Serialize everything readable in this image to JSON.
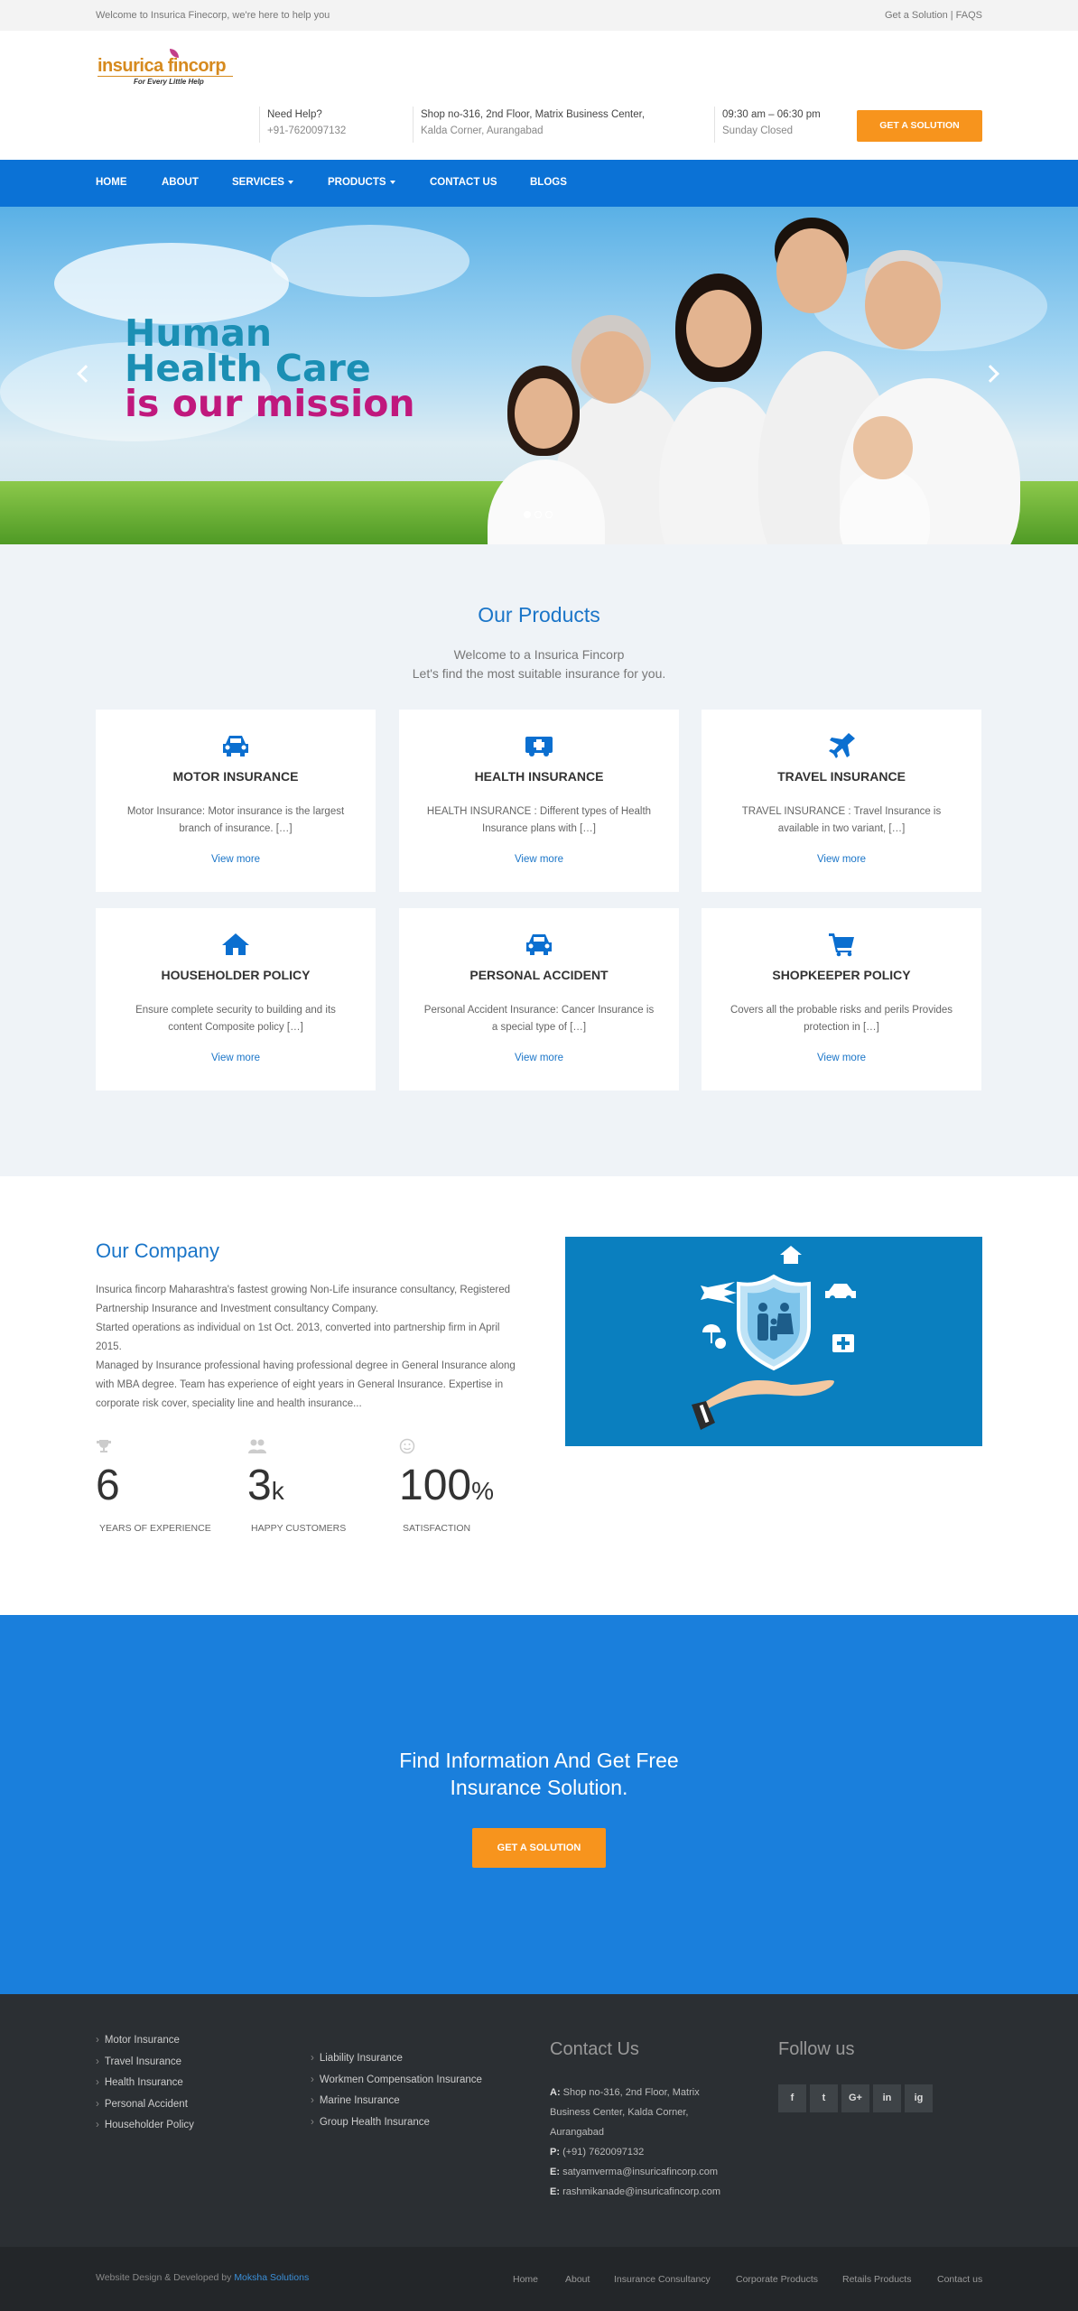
{
  "topbar": {
    "welcome": "Welcome to Insurica Finecorp, we're here to help you",
    "right": "Get a Solution | FAQS"
  },
  "header": {
    "logo_text": "insurica fincorp",
    "logo_tagline": "For Every Little Help",
    "help_label": "Need Help?",
    "help_phone": "+91-7620097132",
    "address_line1": "Shop no-316, 2nd Floor, Matrix Business Center,",
    "address_line2": "Kalda Corner, Aurangabad",
    "hours_line1": "09:30 am – 06:30 pm",
    "hours_line2": "Sunday Closed",
    "cta": "GET A SOLUTION"
  },
  "nav": {
    "home": "HOME",
    "about": "ABOUT",
    "services": "SERVICES",
    "products": "PRODUCTS",
    "contact": "CONTACT US",
    "blogs": "BLOGS"
  },
  "hero": {
    "line1": "Human",
    "line2": "Health Care",
    "line3": "is our mission",
    "slide_count": 3,
    "active_slide": 1
  },
  "products": {
    "title": "Our Products",
    "sub1": "Welcome to a Insurica Fincorp",
    "sub2": "Let's find the most suitable insurance for you.",
    "view_more": "View more",
    "items": [
      {
        "icon": "car-icon",
        "title": "MOTOR INSURANCE",
        "desc": "Motor Insurance: Motor insurance is the largest branch of insurance. […]"
      },
      {
        "icon": "ambulance-icon",
        "title": "HEALTH INSURANCE",
        "desc": "HEALTH  INSURANCE : Different  types of Health Insurance plans with […]"
      },
      {
        "icon": "plane-icon",
        "title": "TRAVEL INSURANCE",
        "desc": "TRAVEL INSURANCE : Travel Insurance is available in two variant, […]"
      },
      {
        "icon": "home-icon",
        "title": "HOUSEHOLDER POLICY",
        "desc": "Ensure complete security to building and its content Composite policy […]"
      },
      {
        "icon": "car-icon",
        "title": "PERSONAL ACCIDENT",
        "desc": "Personal Accident Insurance: Cancer Insurance is a special type of […]"
      },
      {
        "icon": "cart-icon",
        "title": "SHOPKEEPER POLICY",
        "desc": "Covers all the probable risks and perils Provides protection in […]"
      }
    ]
  },
  "company": {
    "title": "Our Company",
    "p1": "Insurica fincorp Maharashtra's fastest growing Non-Life insurance consultancy, Registered Partnership Insurance and Investment consultancy Company.",
    "p2": "Started operations as individual on 1st Oct. 2013, converted into partnership firm in April 2015.",
    "p3": "Managed by Insurance professional having professional degree in General Insurance along with MBA degree. Team has experience of eight years in General Insurance. Expertise in corporate risk cover, speciality line and health insurance...",
    "stats": [
      {
        "icon": "trophy-icon",
        "value": "6",
        "suffix": "",
        "label": "YEARS OF EXPERIENCE"
      },
      {
        "icon": "users-icon",
        "value": "3",
        "suffix": "k",
        "label": "HAPPY CUSTOMERS"
      },
      {
        "icon": "smile-icon",
        "value": "100",
        "suffix": "%",
        "label": "SATISFACTION"
      }
    ]
  },
  "cta": {
    "line1": "Find Information And Get Free",
    "line2": "Insurance Solution.",
    "button": "GET A SOLUTION"
  },
  "footer": {
    "col1": [
      "Motor Insurance",
      "Travel Insurance",
      "Health Insurance",
      "Personal Accident",
      "Householder Policy"
    ],
    "col2": [
      "Liability Insurance",
      "Workmen Compensation Insurance",
      "Marine Insurance",
      "Group Health Insurance"
    ],
    "contact_title": "Contact Us",
    "address_label": "A:",
    "address": "Shop no-316, 2nd Floor, Matrix Business Center, Kalda Corner, Aurangabad",
    "phone_label": "P:",
    "phone": "(+91) 7620097132",
    "email_label": "E:",
    "email1": "satyamverma@insuricafincorp.com",
    "email2": "rashmikanade@insuricafincorp.com",
    "follow_title": "Follow us",
    "social": [
      "f",
      "t",
      "G+",
      "in",
      "ig"
    ]
  },
  "bottom": {
    "credit_prefix": "Website Design & Developed by",
    "credit_company": "Moksha Solutions",
    "links": [
      "Home",
      "About",
      "Insurance Consultancy",
      "Corporate Products",
      "Retails Products",
      "Contact us"
    ]
  },
  "colors": {
    "primary": "#0b72d6",
    "accent": "#f7941d",
    "footer": "#2b2f33"
  }
}
